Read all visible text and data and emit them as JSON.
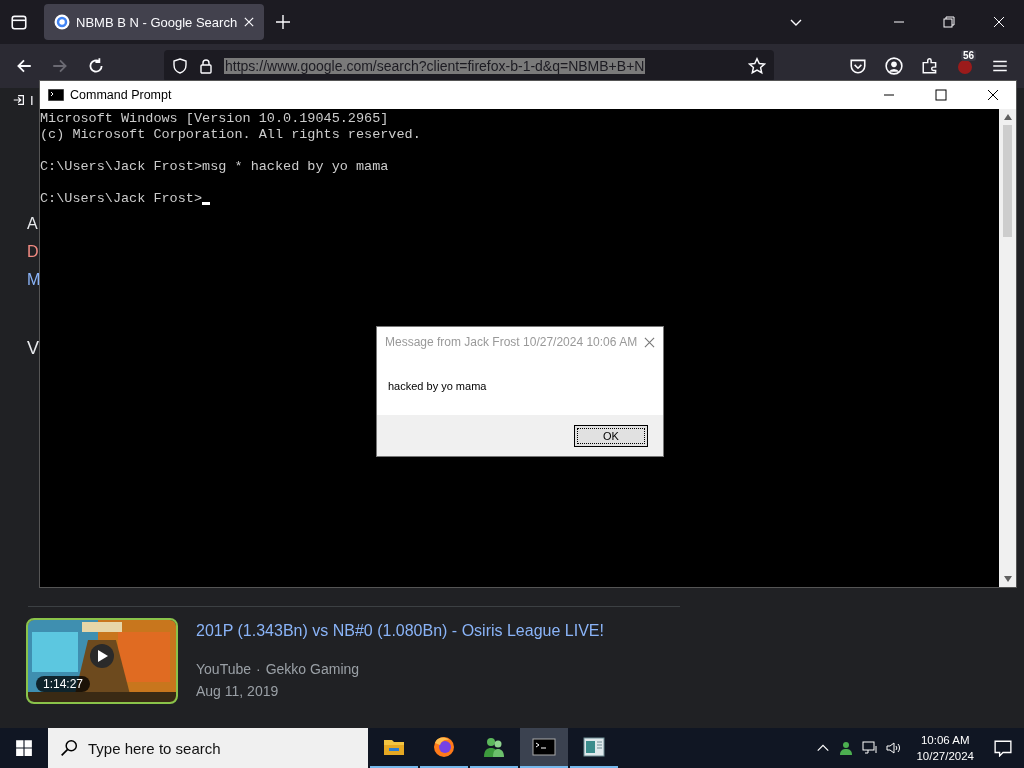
{
  "browser": {
    "tab": {
      "title": "NBMB B N - Google Search",
      "selected": true
    },
    "address": "https://www.google.com/search?client=firefox-b-1-d&q=NBMB+B+N",
    "addon_badge": "56",
    "bookmark": "I",
    "page_fragments": [
      {
        "text": "A",
        "kind": "plain"
      },
      {
        "text": "D",
        "kind": "red"
      },
      {
        "text": "M",
        "kind": "blue"
      },
      {
        "text": "V",
        "kind": "heading"
      }
    ],
    "video": {
      "title": "201P (1.343Bn) vs NB#0 (1.080Bn) - Osiris League LIVE!",
      "source": "YouTube",
      "separator": "·",
      "channel": "Gekko Gaming",
      "date": "Aug 11, 2019",
      "duration": "1:14:27"
    }
  },
  "console": {
    "title": "Command Prompt",
    "paragraphs": [
      [
        "Microsoft Windows [Version 10.0.19045.2965]",
        "(c) Microsoft Corporation. All rights reserved."
      ],
      [
        "C:\\Users\\Jack Frost>msg * hacked by yo mama"
      ],
      [
        "C:\\Users\\Jack Frost>"
      ]
    ]
  },
  "message_box": {
    "title": "Message from Jack Frost 10/27/2024 10:06 AM",
    "text": "hacked by yo mama",
    "button": "OK"
  },
  "taskbar": {
    "search_placeholder": "Type here to search",
    "apps": [
      {
        "kind": "folder",
        "selected": false
      },
      {
        "kind": "firefox",
        "selected": false
      },
      {
        "kind": "people",
        "selected": false
      },
      {
        "kind": "console",
        "selected": true
      },
      {
        "kind": "window",
        "selected": false
      }
    ],
    "time": "10:06 AM",
    "date": "10/27/2024"
  }
}
